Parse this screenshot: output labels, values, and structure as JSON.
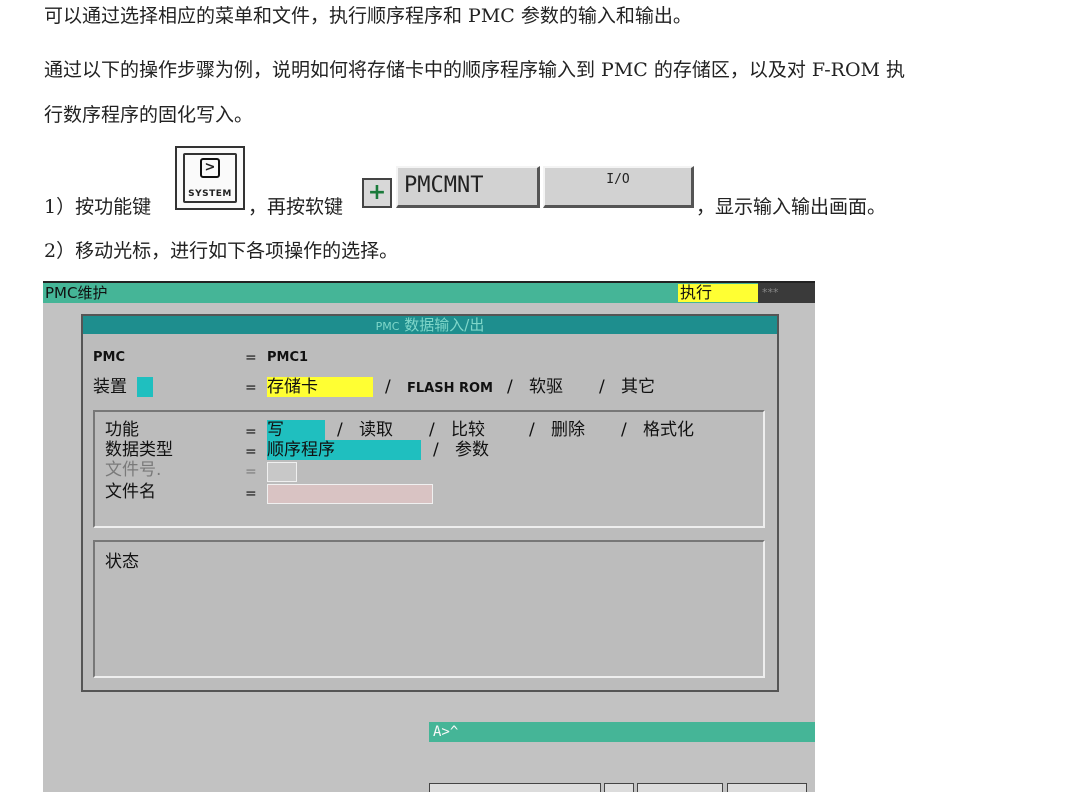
{
  "doc": {
    "para1": "可以通过选择相应的菜单和文件，执行顺序程序和 PMC 参数的输入和输出。",
    "para2": "通过以下的操作步骤为例，说明如何将存储卡中的顺序程序输入到 PMC 的存储区，以及对 F-ROM 执",
    "para3": "行数序程序的固化写入。",
    "step1_a": "1）按功能键",
    "step1_b": "，再按软键",
    "step1_c": "，显示输入输出画面。",
    "step2": "2）移动光标，进行如下各项操作的选择。"
  },
  "keys": {
    "system_label": "SYSTEM",
    "plus": "+",
    "soft1": "PMCMNT",
    "soft2": "I/O"
  },
  "screen": {
    "title": "PMC维护",
    "exec": "执行",
    "stars": "***",
    "panel_title_a": "PMC",
    "panel_title_b": "数据输入/出",
    "pmc_label": "PMC",
    "pmc_value": "PMC1",
    "device_label": "装置",
    "device_opts": [
      "存储卡",
      "FLASH ROM",
      "软驱",
      "其它"
    ],
    "function_label": "功能",
    "function_opts": [
      "写",
      "读取",
      "比较",
      "删除",
      "格式化"
    ],
    "datatype_label": "数据类型",
    "datatype_opts": [
      "顺序程序",
      "参数"
    ],
    "fileno_label": "文件号.",
    "filename_label": "文件名",
    "status_label": "状态",
    "cmd_prompt": "A>^",
    "eq": "=",
    "slash": "/"
  }
}
